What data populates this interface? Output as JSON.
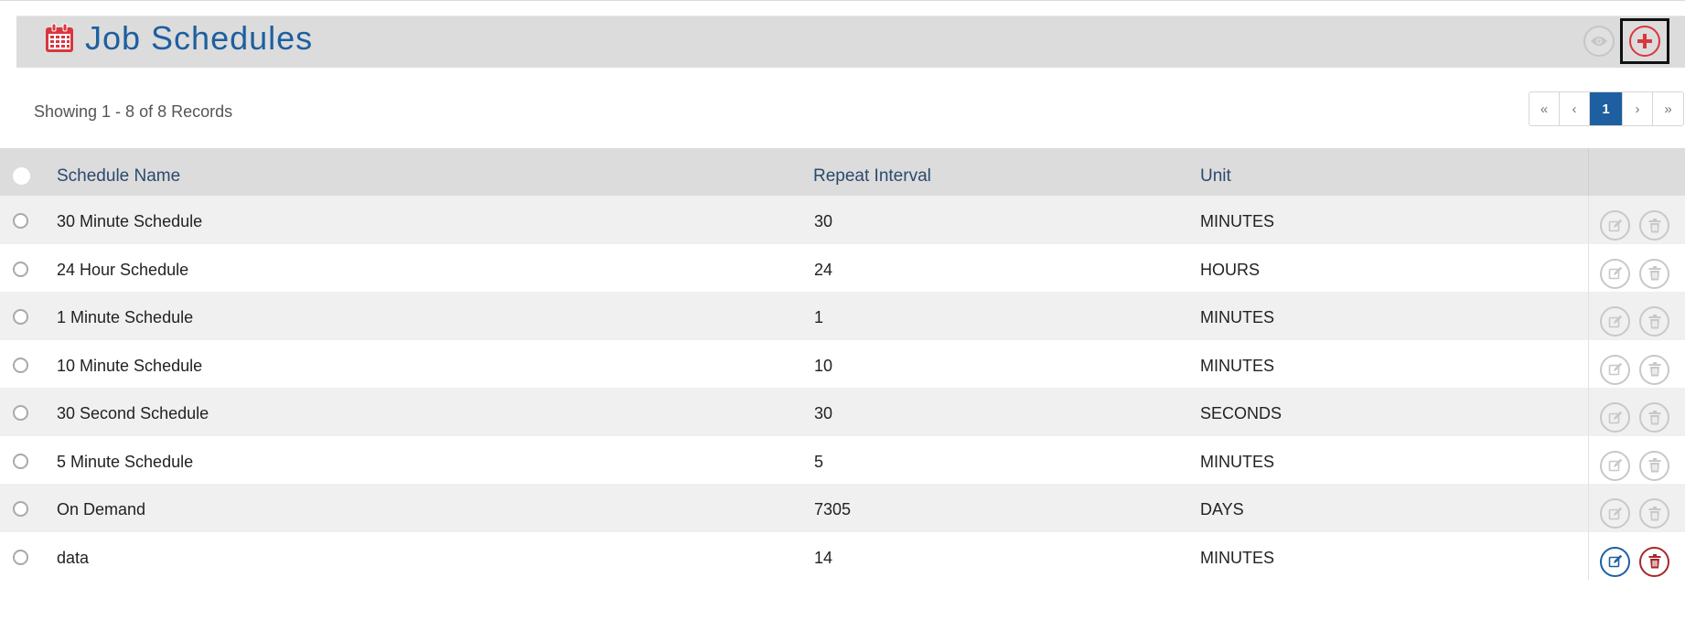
{
  "header": {
    "title": "Job Schedules",
    "icon": "calendar-icon",
    "accent_color": "#1d5fa0",
    "icon_color": "#d9363e",
    "view_button_icon": "eye-icon",
    "add_button_icon": "plus-circle-icon"
  },
  "summary": {
    "showing_text": "Showing 1 - 8 of 8 Records"
  },
  "pagination": {
    "first": "«",
    "prev": "‹",
    "current": "1",
    "next": "›",
    "last": "»"
  },
  "table": {
    "columns": {
      "name": "Schedule Name",
      "interval": "Repeat Interval",
      "unit": "Unit"
    },
    "rows": [
      {
        "name": "30 Minute Schedule",
        "interval": "30",
        "unit": "MINUTES",
        "actions_enabled": false
      },
      {
        "name": "24 Hour Schedule",
        "interval": "24",
        "unit": "HOURS",
        "actions_enabled": false
      },
      {
        "name": "1 Minute Schedule",
        "interval": "1",
        "unit": "MINUTES",
        "actions_enabled": false
      },
      {
        "name": "10 Minute Schedule",
        "interval": "10",
        "unit": "MINUTES",
        "actions_enabled": false
      },
      {
        "name": "30 Second Schedule",
        "interval": "30",
        "unit": "SECONDS",
        "actions_enabled": false
      },
      {
        "name": "5 Minute Schedule",
        "interval": "5",
        "unit": "MINUTES",
        "actions_enabled": false
      },
      {
        "name": "On Demand",
        "interval": "7305",
        "unit": "DAYS",
        "actions_enabled": false
      },
      {
        "name": "data",
        "interval": "14",
        "unit": "MINUTES",
        "actions_enabled": true
      }
    ]
  }
}
